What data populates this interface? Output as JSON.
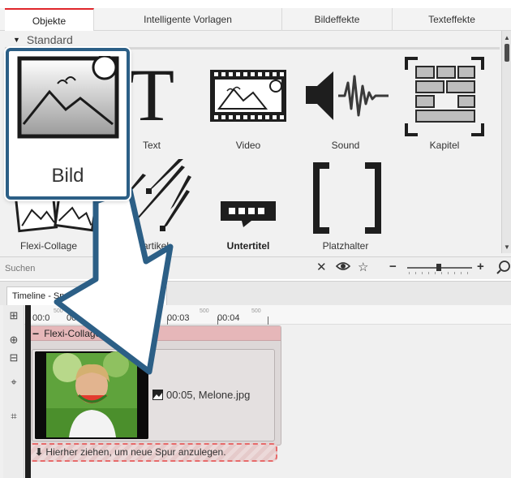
{
  "tabs": [
    {
      "label": "Objekte",
      "active": true
    },
    {
      "label": "Intelligente Vorlagen",
      "active": false
    },
    {
      "label": "Bildeffekte",
      "active": false
    },
    {
      "label": "Texteffekte",
      "active": false
    }
  ],
  "group": {
    "label": "Standard"
  },
  "objects": {
    "bild": "Bild",
    "text": "Text",
    "video": "Video",
    "sound": "Sound",
    "kapitel": "Kapitel",
    "flexi_collage": "Flexi-Collage",
    "partikel": "Partikel",
    "untertitel": "Untertitel",
    "platzhalter": "Platzhalter"
  },
  "search": {
    "placeholder": "Suchen"
  },
  "timeline": {
    "tab_label": "Timeline - Spur",
    "ruler": [
      "00:0",
      "00:0",
      "00:03",
      "00:04"
    ],
    "ruler_small": [
      "500",
      "500",
      "500",
      "500"
    ],
    "track_name": "Flexi-Collage",
    "clip_info": "00:05, Melone.jpg",
    "drop_hint": "Hierher ziehen, um neue Spur anzulegen."
  },
  "colors": {
    "accent": "#e0262b",
    "highlight_border": "#2c5f86",
    "track_header": "#e6b7b9"
  },
  "icons": [
    "image-icon",
    "text-icon",
    "video-icon",
    "speaker-icon",
    "chapter-icon",
    "collage-icon",
    "particle-icon",
    "subtitle-icon",
    "placeholder-icon",
    "clear-icon",
    "eye-icon",
    "star-icon",
    "zoom-icon",
    "drag-arrow-icon"
  ]
}
